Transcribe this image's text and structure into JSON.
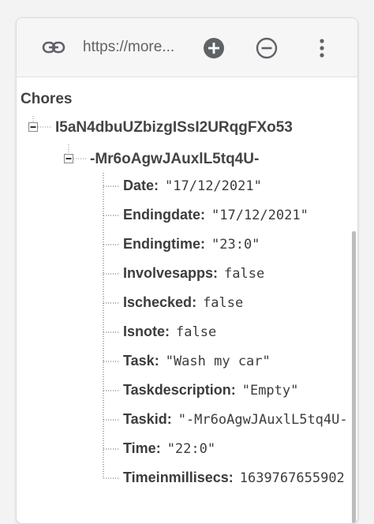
{
  "toolbar": {
    "url": "https://more...",
    "icons": {
      "link": "link-icon",
      "add": "add-circle-icon",
      "remove": "remove-circle-icon",
      "more": "more-vert-icon"
    }
  },
  "tree": {
    "root": "Chores",
    "child_key": "I5aN4dbuUZbizgISsI2URqgFXo53",
    "grandchild_key": "-Mr6oAgwJAuxlL5tq4U-",
    "fields": [
      {
        "key": "Date",
        "value": "\"17/12/2021\""
      },
      {
        "key": "Endingdate",
        "value": "\"17/12/2021\""
      },
      {
        "key": "Endingtime",
        "value": "\"23:0\""
      },
      {
        "key": "Involvesapps",
        "value": "false"
      },
      {
        "key": "Ischecked",
        "value": "false"
      },
      {
        "key": "Isnote",
        "value": "false"
      },
      {
        "key": "Task",
        "value": "\"Wash my car\""
      },
      {
        "key": "Taskdescription",
        "value": "\"Empty\""
      },
      {
        "key": "Taskid",
        "value": "\"-Mr6oAgwJAuxlL5tq4U-"
      },
      {
        "key": "Time",
        "value": "\"22:0\""
      },
      {
        "key": "Timeinmillisecs",
        "value": "1639767655902"
      }
    ]
  },
  "colors": {
    "text": "#444444",
    "toolbar_bg": "#f6f6f6",
    "icon": "#5f6368"
  }
}
